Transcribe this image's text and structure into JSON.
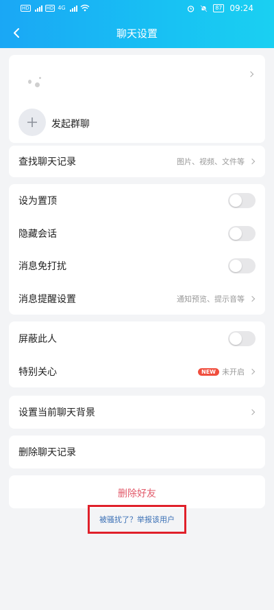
{
  "status": {
    "sim1": "HD",
    "sim2": "HD",
    "network": "4G",
    "battery": "87",
    "time": "09:24"
  },
  "nav": {
    "title": "聊天设置"
  },
  "profile": {
    "add_group_label": "发起群聊"
  },
  "search_history": {
    "label": "查找聊天记录",
    "hint": "图片、视频、文件等"
  },
  "settings": {
    "pin_label": "设为置顶",
    "hide_label": "隐藏会话",
    "mute_label": "消息免打扰",
    "reminder_label": "消息提醒设置",
    "reminder_hint": "通知预览、提示音等"
  },
  "privacy": {
    "block_label": "屏蔽此人",
    "special_label": "特别关心",
    "new_badge": "NEW",
    "special_status": "未开启"
  },
  "background": {
    "label": "设置当前聊天背景"
  },
  "clear": {
    "label": "删除聊天记录"
  },
  "delete": {
    "label": "删除好友"
  },
  "report": {
    "label": "被骚扰了？举报该用户"
  },
  "toggles": {
    "pin": false,
    "hide": false,
    "mute": false,
    "block": false
  },
  "colors": {
    "header": "#1aa7f5",
    "danger": "#e25a6a",
    "link": "#3a6fb5",
    "highlight_box": "#e0202a",
    "new_badge": "#f04e3e"
  }
}
